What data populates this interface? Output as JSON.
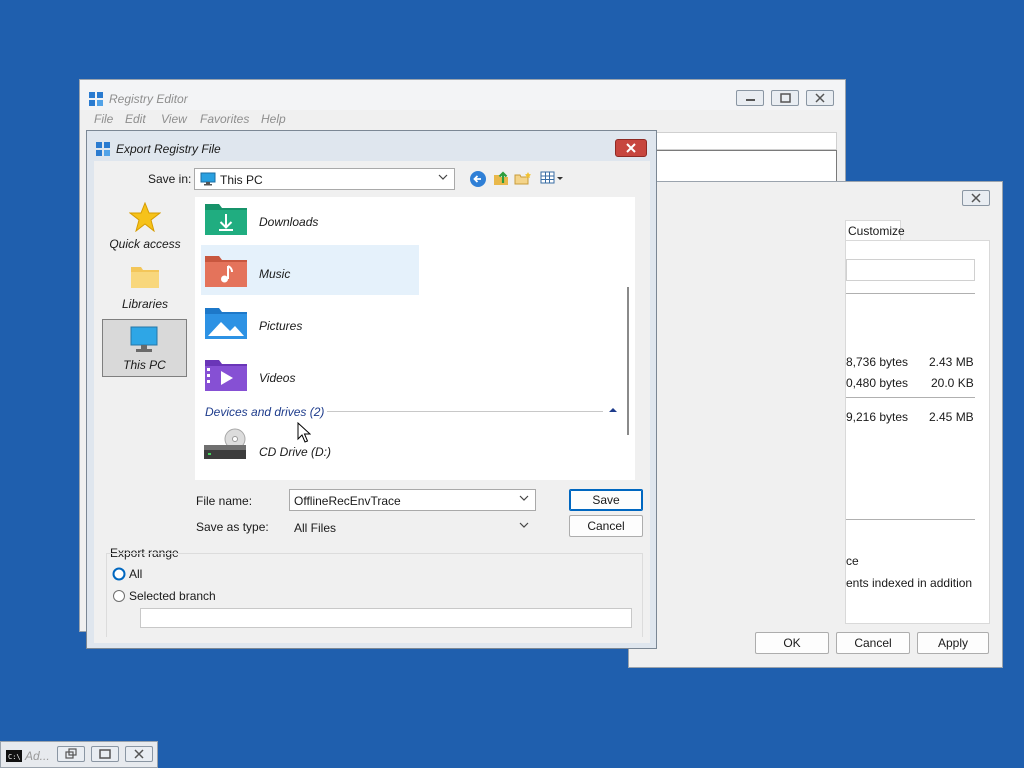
{
  "registry_editor": {
    "title": "Registry Editor",
    "menu": [
      "File",
      "Edit",
      "View",
      "Favorites",
      "Help"
    ]
  },
  "properties_window": {
    "tab_label": "Customize",
    "sizes": [
      {
        "bytes": "8,736 bytes",
        "size": "2.43 MB"
      },
      {
        "bytes": "0,480 bytes",
        "size": "20.0 KB"
      },
      {
        "bytes": "9,216 bytes",
        "size": "2.45 MB"
      }
    ],
    "text_line1": "ce",
    "text_line2": "ents indexed in addition",
    "ok_label": "OK",
    "cancel_label": "Cancel",
    "apply_label": "Apply"
  },
  "dialog": {
    "title": "Export Registry File",
    "save_in_label": "Save in:",
    "save_in_value": "This PC",
    "sidebar": [
      {
        "label": "Quick access",
        "icon": "star-icon"
      },
      {
        "label": "Libraries",
        "icon": "libraries-folder-icon"
      },
      {
        "label": "This PC",
        "icon": "this-pc-icon"
      }
    ],
    "folders": [
      {
        "label": "Downloads",
        "icon": "downloads-folder-icon"
      },
      {
        "label": "Music",
        "icon": "music-folder-icon"
      },
      {
        "label": "Pictures",
        "icon": "pictures-folder-icon"
      },
      {
        "label": "Videos",
        "icon": "videos-folder-icon"
      }
    ],
    "devices_header": "Devices and drives (2)",
    "drive_label": "CD Drive (D:)",
    "file_name_label": "File name:",
    "file_name_value": "OfflineRecEnvTrace",
    "save_as_type_label": "Save as type:",
    "save_as_type_value": "All Files",
    "save_label": "Save",
    "cancel_label": "Cancel",
    "export_range_label": "Export range",
    "option_all": "All",
    "option_selected": "Selected branch",
    "branch_value": ""
  },
  "taskbar": {
    "console_title": "Ad..."
  },
  "colors": {
    "desktop": "#1f5fae",
    "close_red": "#c7463e",
    "selection": "#e5f1fb",
    "accent": "#0067c0"
  }
}
